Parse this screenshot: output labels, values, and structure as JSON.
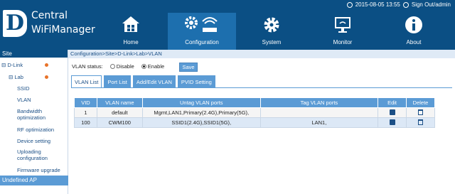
{
  "topbar": {
    "datetime": "2015-08-05 13:55",
    "signout": "Sign Out/admin"
  },
  "logo": {
    "letter": "D",
    "line1": "Central",
    "line2": "WiFiManager"
  },
  "nav": [
    {
      "label": "Home",
      "icon": "home-icon"
    },
    {
      "label": "Configuration",
      "icon": "gear-wifi-icon",
      "active": true
    },
    {
      "label": "System",
      "icon": "gear-icon"
    },
    {
      "label": "Monitor",
      "icon": "monitor-icon"
    },
    {
      "label": "About",
      "icon": "info-icon"
    }
  ],
  "sidebar": {
    "header": "Site",
    "items": [
      {
        "label": "D-Link",
        "prefix": "⊟"
      },
      {
        "label": "Lab",
        "prefix": "⊟"
      },
      {
        "label": "SSID"
      },
      {
        "label": "VLAN"
      },
      {
        "label": "Bandwidth optimization"
      },
      {
        "label": "RF optimization"
      },
      {
        "label": "Device setting"
      },
      {
        "label": "Uploading configuration"
      },
      {
        "label": "Firmware upgrade"
      }
    ],
    "footer": "Undefined AP"
  },
  "breadcrumb": "Configuration>Site>D-Link>Lab>VLAN",
  "vlan_status": {
    "label": "VLAN status:",
    "disable": "Disable",
    "enable": "Enable",
    "selected": "Enable",
    "save": "Save"
  },
  "tabs": [
    "VLAN List",
    "Port List",
    "Add/Edit VLAN",
    "PVID Setting"
  ],
  "table": {
    "headers": [
      "VID",
      "VLAN name",
      "Untag VLAN ports",
      "Tag VLAN ports",
      "Edit",
      "Delete"
    ],
    "rows": [
      {
        "vid": "1",
        "name": "default",
        "untag": "Mgmt,LAN1,Primary(2.4G),Primary(5G),",
        "tag": ""
      },
      {
        "vid": "100",
        "name": "CWM100",
        "untag": "SSID1(2.4G),SSID1(5G),",
        "tag": "LAN1,"
      }
    ]
  },
  "colors": {
    "header": "#0b4f84",
    "active_nav": "#1d6fae",
    "accent": "#5b9bd5"
  }
}
